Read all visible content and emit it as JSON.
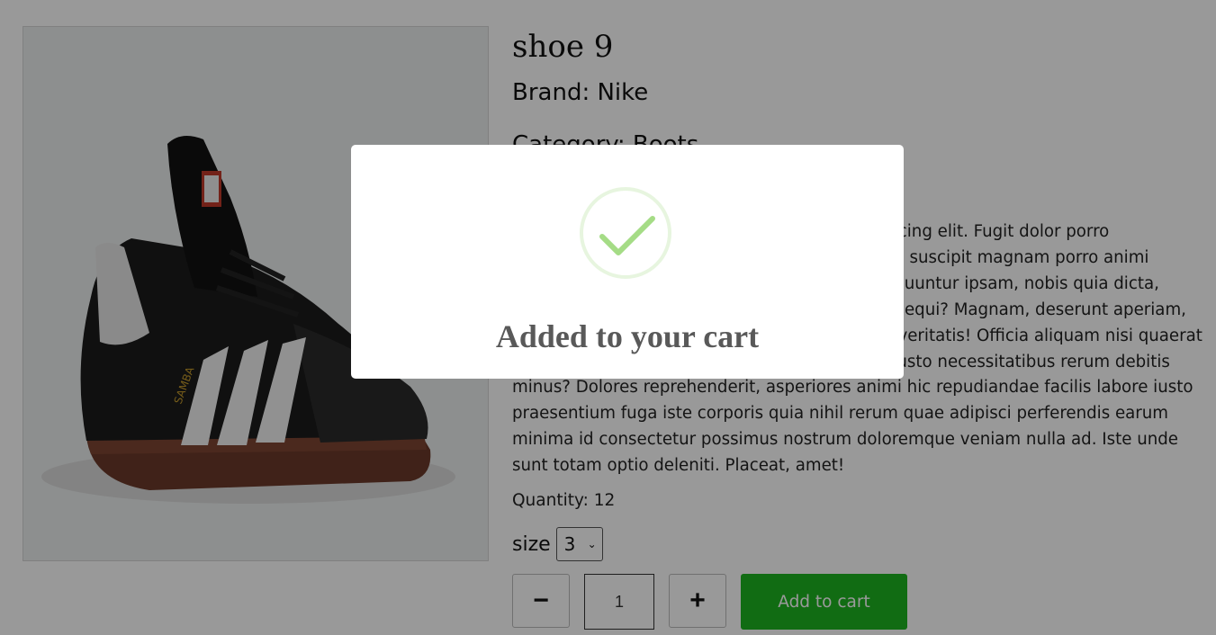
{
  "product": {
    "title": "shoe 9",
    "brand": "Brand: Nike",
    "category": "Category: Boots",
    "description": "Lorem ipsum dolor sit amet consectetur adipisicing elit. Fugit dolor porro quibusdam, temporibus asperiores odit dolores, suscipit magnam porro animi accusamus omnis voluptatibus voluptas consequuntur ipsam, nobis quia dicta, atque quam laboriosam dolores expedita, iure sequi? Magnam, deserunt aperiam, reiciendis voluptatum temporibus molestias in veritatis! Officia aliquam nisi quaerat voluptates, fugit unde corrupti ipsam, dolores iusto necessitatibus rerum debitis minus? Dolores reprehenderit, asperiores animi hic repudiandae facilis labore iusto praesentium fuga iste corporis quia nihil rerum quae adipisci perferendis earum minima id consectetur possimus nostrum doloremque veniam nulla ad. Iste unde sunt totam optio deleniti. Placeat, amet!",
    "quantity_text": "Quantity: 12",
    "size_label": "size",
    "size_value": "3",
    "qty_value": "1",
    "minus_label": "−",
    "plus_label": "+",
    "add_to_cart_label": "Add to cart",
    "image_icon": "black-leather-sneaker-with-white-stripes"
  },
  "modal": {
    "icon": "success-check-icon",
    "message": "Added to your cart"
  },
  "colors": {
    "accent": "#1db521",
    "overlay": "rgba(0,0,0,0.4)",
    "check": "#a5dc86"
  }
}
